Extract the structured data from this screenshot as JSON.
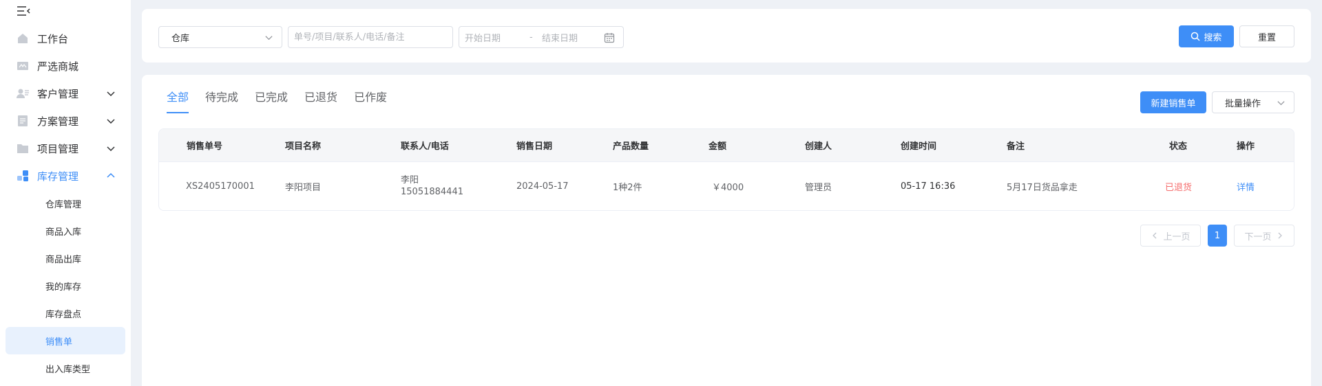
{
  "sidebar": {
    "items": [
      {
        "label": "工作台",
        "icon": "home-icon"
      },
      {
        "label": "严选商城",
        "icon": "store-icon"
      },
      {
        "label": "客户管理",
        "icon": "customer-icon"
      },
      {
        "label": "方案管理",
        "icon": "document-icon"
      },
      {
        "label": "项目管理",
        "icon": "folder-icon"
      },
      {
        "label": "库存管理",
        "icon": "inventory-icon"
      }
    ],
    "sub_items": [
      {
        "label": "仓库管理"
      },
      {
        "label": "商品入库"
      },
      {
        "label": "商品出库"
      },
      {
        "label": "我的库存"
      },
      {
        "label": "库存盘点"
      },
      {
        "label": "销售单"
      },
      {
        "label": "出入库类型"
      }
    ]
  },
  "filters": {
    "warehouse_select": "仓库",
    "keyword_placeholder": "单号/项目/联系人/电话/备注",
    "start_date_placeholder": "开始日期",
    "date_separator": "-",
    "end_date_placeholder": "结束日期",
    "search_label": "搜索",
    "reset_label": "重置"
  },
  "tabs": [
    {
      "label": "全部"
    },
    {
      "label": "待完成"
    },
    {
      "label": "已完成"
    },
    {
      "label": "已退货"
    },
    {
      "label": "已作废"
    }
  ],
  "actions": {
    "new_label": "新建销售单",
    "batch_label": "批量操作"
  },
  "table": {
    "headers": [
      "销售单号",
      "项目名称",
      "联系人/电话",
      "销售日期",
      "产品数量",
      "金额",
      "创建人",
      "创建时间",
      "备注",
      "状态",
      "操作"
    ],
    "rows": [
      {
        "order_no": "XS2405170001",
        "project": "李阳项目",
        "contact_name": "李阳",
        "contact_phone": "15051884441",
        "sale_date": "2024-05-17",
        "quantity": "1种2件",
        "amount": "￥4000",
        "creator": "管理员",
        "created_at": "05-17 16:36",
        "remark": "5月17日货品拿走",
        "status": "已退货",
        "action": "详情"
      }
    ]
  },
  "pagination": {
    "prev_label": "上一页",
    "current_page": "1",
    "next_label": "下一页"
  },
  "colors": {
    "primary": "#3e8ef7",
    "status_returned": "#f56c6c"
  }
}
